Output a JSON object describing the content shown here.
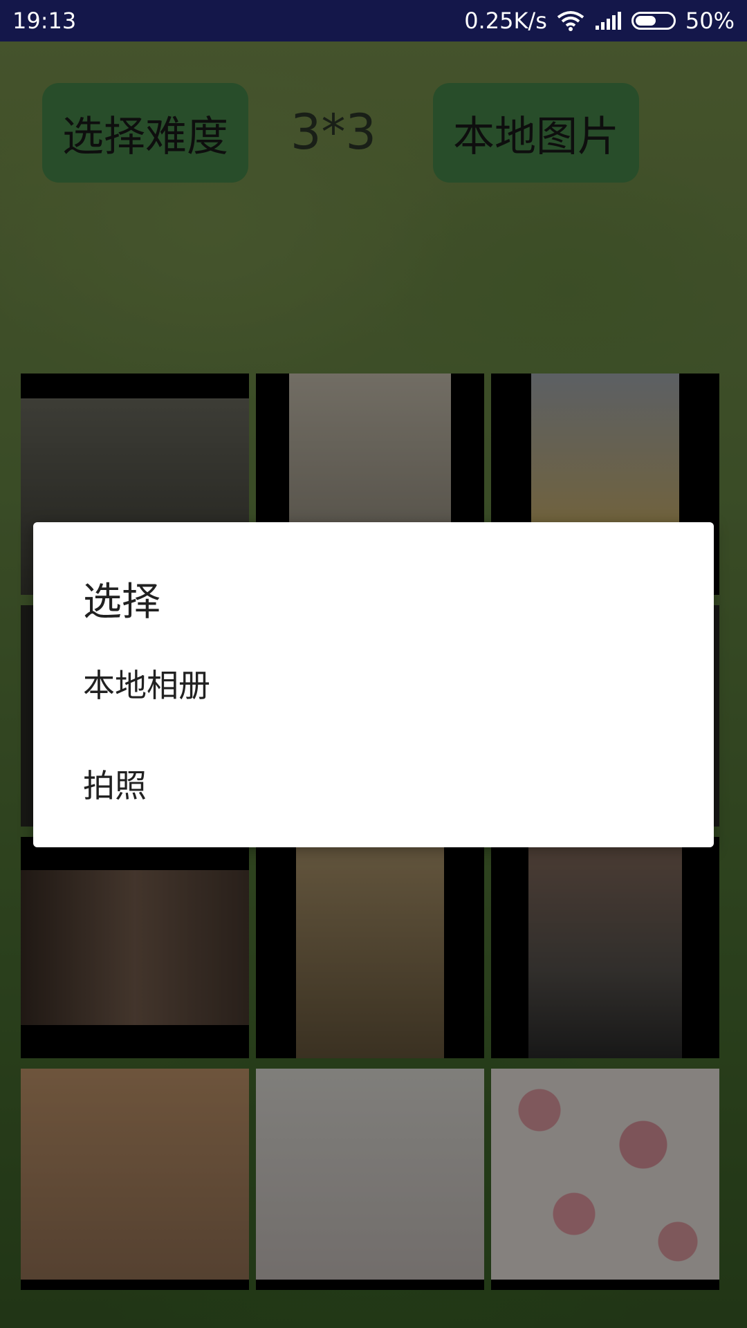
{
  "status_bar": {
    "time": "19:13",
    "net_speed": "0.25K/s",
    "battery_percent": "50%",
    "battery_level": 0.5,
    "icons": [
      "wifi-icon",
      "signal-icon",
      "battery-icon"
    ]
  },
  "top": {
    "difficulty_button": "选择难度",
    "level": "3*3",
    "local_image_button": "本地图片"
  },
  "grid": {
    "tiles": [
      {
        "label": "photo-tile-1"
      },
      {
        "label": "photo-tile-2"
      },
      {
        "label": "photo-tile-3"
      },
      {
        "label": "photo-tile-4"
      },
      {
        "label": "photo-tile-5"
      },
      {
        "label": "photo-tile-6"
      },
      {
        "label": "photo-tile-7"
      },
      {
        "label": "photo-tile-8"
      },
      {
        "label": "photo-tile-9"
      },
      {
        "label": "photo-tile-10"
      },
      {
        "label": "photo-tile-11"
      },
      {
        "label": "photo-tile-12"
      }
    ]
  },
  "dialog": {
    "title": "选择",
    "items": [
      "本地相册",
      "拍照"
    ]
  },
  "colors": {
    "status_bar": "#14174a",
    "button": "#4a8c4d",
    "dialog": "#ffffff"
  }
}
